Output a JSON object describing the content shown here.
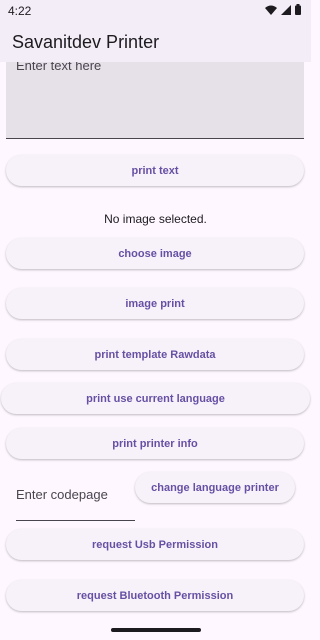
{
  "status_bar": {
    "time": "4:22"
  },
  "app_bar": {
    "title": "Savanitdev Printer"
  },
  "text_input": {
    "placeholder": "Enter text here"
  },
  "buttons": {
    "print_text": "print text",
    "choose_image": "choose image",
    "image_print": "image print",
    "print_template_rawdata": "print template Rawdata",
    "print_use_current_language": "print use current language",
    "print_printer_info": "print printer info",
    "change_language_printer": "change language printer",
    "request_usb_permission": "request Usb Permission",
    "request_bluetooth_permission": "request Bluetooth Permission"
  },
  "image_status": "No image selected.",
  "codepage_input": {
    "placeholder": "Enter codepage"
  },
  "colors": {
    "accent": "#6750a4",
    "background": "#fef7ff",
    "app_bar": "#f3edf7",
    "text_field_fill": "#e6e0e9"
  }
}
